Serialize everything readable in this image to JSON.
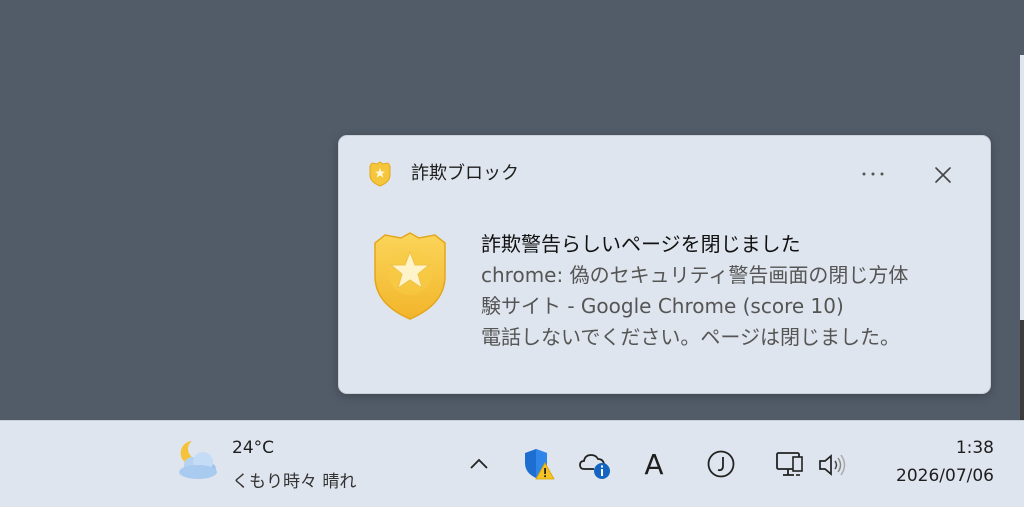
{
  "notification": {
    "app_name": "詐欺ブロック",
    "title": "詐欺警告らしいページを閉じました",
    "body_lines": [
      "chrome: 偽のセキュリティ警告画面の閉じ方体",
      "験サイト - Google Chrome (score 10)",
      "電話しないでください。ページは閉じました。"
    ],
    "more_label": "···",
    "close_label": "✕"
  },
  "taskbar": {
    "weather": {
      "temperature": "24°C",
      "condition": "くもり時々 晴れ",
      "icon": "partly-cloudy-night-icon"
    },
    "tray": {
      "chevron": "^",
      "ime_label": "A",
      "icons": [
        "chevron-up-icon",
        "defender-warning-icon",
        "onedrive-info-icon",
        "ime-mode-icon",
        "ime-japanese-icon",
        "network-icon",
        "volume-icon"
      ]
    },
    "clock": {
      "time": "1:38",
      "date": "2026/07/06"
    }
  },
  "colors": {
    "desktop": "#525c69",
    "toast_bg": "#dfe5ee",
    "taskbar_bg": "#dfe5ee",
    "shield_gold": "#f7c948"
  }
}
